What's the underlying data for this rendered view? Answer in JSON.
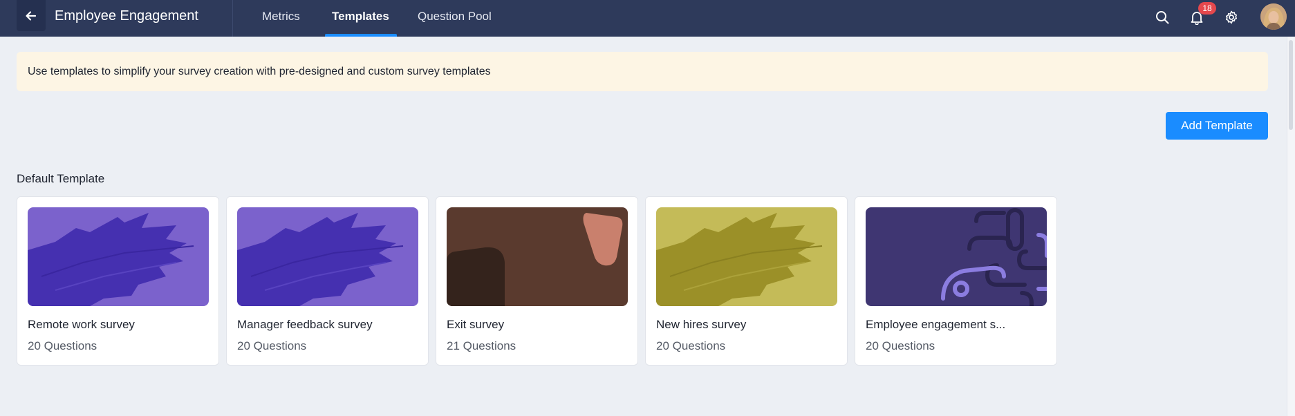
{
  "header": {
    "back_label": "Back",
    "app_title": "Employee Engagement",
    "tabs": [
      {
        "label": "Metrics",
        "active": false
      },
      {
        "label": "Templates",
        "active": true
      },
      {
        "label": "Question Pool",
        "active": false
      }
    ],
    "notification_count": "18",
    "icons": [
      "arrow-left-icon",
      "search-icon",
      "bell-icon",
      "gear-icon",
      "avatar"
    ]
  },
  "banner": {
    "text": "Use templates to simplify your survey creation with pre-designed and custom survey templates"
  },
  "actions": {
    "add_template_label": "Add Template"
  },
  "section": {
    "title": "Default Template"
  },
  "templates": [
    {
      "title": "Remote work survey",
      "questions": "20 Questions",
      "theme": "purple-brush",
      "colors": [
        "#7b62cc",
        "#4530b0"
      ]
    },
    {
      "title": "Manager feedback survey",
      "questions": "20 Questions",
      "theme": "purple-brush",
      "colors": [
        "#7b62cc",
        "#4530b0"
      ]
    },
    {
      "title": "Exit survey",
      "questions": "21 Questions",
      "theme": "brown-blocks",
      "colors": [
        "#5a3a2e",
        "#34231c",
        "#c9806d"
      ]
    },
    {
      "title": "New hires survey",
      "questions": "20 Questions",
      "theme": "olive-brush",
      "colors": [
        "#c4bb58",
        "#9b9028"
      ]
    },
    {
      "title": "Employee engagement s...",
      "questions": "20 Questions",
      "theme": "indigo-shapes",
      "colors": [
        "#3f3672",
        "#2a2450",
        "#8b7de0"
      ]
    }
  ],
  "colors": {
    "topbar": "#2e3a5b",
    "accent": "#1a8cff",
    "page_bg": "#eceff4",
    "banner_bg": "#fdf5e4",
    "badge": "#e5484d"
  }
}
